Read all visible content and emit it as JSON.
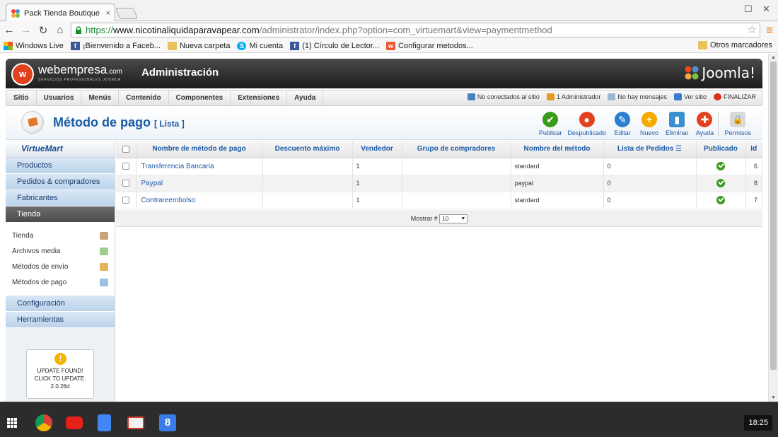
{
  "browser": {
    "tab_title": "Pack Tienda Boutique - A",
    "tab_close": "×",
    "url_scheme": "https://",
    "url_host": "www.nicotinaliquidaparavapear.com",
    "url_path": "/administrator/index.php?option=com_virtuemart&view=paymentmethod",
    "bookmarks": [
      {
        "label": "Windows Live",
        "icon": "windows-icon"
      },
      {
        "label": "¡Bienvenido a Faceb...",
        "icon": "facebook-icon"
      },
      {
        "label": "Nueva carpeta",
        "icon": "folder-icon"
      },
      {
        "label": "Mi cuenta",
        "icon": "skype-icon"
      },
      {
        "label": "(1) Círculo de Lector...",
        "icon": "facebook-icon"
      },
      {
        "label": "Configurar metodos...",
        "icon": "webempresa-icon"
      }
    ],
    "other_bookmarks": "Otros marcadores"
  },
  "admin": {
    "brand": "webempresa",
    "brand_suffix": ".com",
    "brand_tagline": "SERVICIOS PROFESIONALES JOOMLA",
    "title": "Administración",
    "joomla": "Joomla!",
    "menu": [
      "Sitio",
      "Usuarios",
      "Menús",
      "Contenido",
      "Componentes",
      "Extensiones",
      "Ayuda"
    ],
    "status": {
      "visitors": "No conectados al sitio",
      "admins": "1 Administrador",
      "messages": "No hay mensajes",
      "view_site": "Ver sitio",
      "logout": "FINALIZAR"
    }
  },
  "page": {
    "title": "Método de pago",
    "subtitle": "[ Lista ]",
    "tools": [
      {
        "label": "Publicar",
        "color": "#3a9a1c",
        "glyph": "✔"
      },
      {
        "label": "Despublicado",
        "color": "#e0411f",
        "glyph": "●"
      },
      {
        "label": "Editar",
        "color": "#2a7fd0",
        "glyph": "✎"
      },
      {
        "label": "Nuevo",
        "color": "#f5a800",
        "glyph": "+"
      },
      {
        "label": "Eliminar",
        "color": "#3a8fd0",
        "glyph": "▮"
      },
      {
        "label": "Ayuda",
        "color": "#e0411f",
        "glyph": "✚"
      },
      {
        "label": "Permisos",
        "color": "#cccccc",
        "glyph": "🔒"
      }
    ]
  },
  "sidebar": {
    "logo": "VirtueMart",
    "sections": [
      "Productos",
      "Pedidos & compradores",
      "Fabricantes",
      "Tienda"
    ],
    "tienda_items": [
      {
        "label": "Tienda",
        "icon": "shop-icon"
      },
      {
        "label": "Archivos media",
        "icon": "media-icon"
      },
      {
        "label": "Métodos de envío",
        "icon": "truck-icon"
      },
      {
        "label": "Métodos de pago",
        "icon": "payment-icon"
      }
    ],
    "bottom_sections": [
      "Configuración",
      "Herramientas"
    ],
    "update": {
      "line1": "UPDATE FOUND!",
      "line2": "CLICK TO UPDATE.",
      "line3": "2.0.26d"
    }
  },
  "table": {
    "columns": [
      "Nombre de método de pago",
      "Descuento máximo",
      "Vendedor",
      "Grupo de compradores",
      "Nombre del método",
      "Lista de Pedidos",
      "Publicado",
      "Id"
    ],
    "rows": [
      {
        "name": "Transferencia Bancaria",
        "discount": "",
        "vendor": "1",
        "group": "",
        "method": "standard",
        "order": "0",
        "published": true,
        "id": "6"
      },
      {
        "name": "Paypal",
        "discount": "",
        "vendor": "1",
        "group": "",
        "method": "paypal",
        "order": "0",
        "published": true,
        "id": "8"
      },
      {
        "name": "Contrareembolso",
        "discount": "",
        "vendor": "1",
        "group": "",
        "method": "standard",
        "order": "0",
        "published": true,
        "id": "7"
      }
    ],
    "pager_label": "Mostrar #",
    "pager_value": "10"
  },
  "taskbar": {
    "apps": [
      {
        "name": "chrome",
        "color": "#db4437"
      },
      {
        "name": "youtube",
        "color": "#e62117"
      },
      {
        "name": "docs",
        "color": "#4285f4"
      },
      {
        "name": "gmail",
        "color": "#d23f31"
      },
      {
        "name": "google",
        "color": "#3b7be8"
      }
    ],
    "clock": "18:25"
  }
}
